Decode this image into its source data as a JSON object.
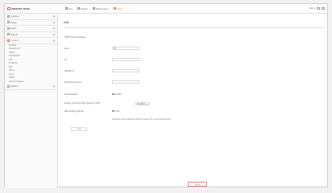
{
  "app": {
    "logo_text": "WISENET WAVE"
  },
  "topnav": [
    {
      "label": "Live",
      "icon": "monitor-icon"
    },
    {
      "label": "Search",
      "icon": "search-icon"
    },
    {
      "label": "Maintenance",
      "icon": "wrench-icon"
    },
    {
      "label": "Setup",
      "icon": "gear-icon",
      "active": true
    }
  ],
  "topright": {
    "user": "admin",
    "icons": [
      "help-icon",
      "logout-icon"
    ]
  },
  "sidebar": {
    "groups": [
      {
        "label": "Camera"
      },
      {
        "label": "Setup"
      },
      {
        "label": "Event"
      },
      {
        "label": "Record"
      },
      {
        "label": "Network",
        "open": true,
        "items": [
          "IP Setup",
          "Network port",
          "DDNS",
          "Fixed DDNS",
          "P2P",
          "IP filtering",
          "SSL",
          "802.1x",
          "Email",
          "SNMP",
          "Auto IP configure"
        ]
      },
      {
        "label": "System"
      }
    ]
  },
  "main": {
    "title": "Mail",
    "section_title": "SMTP Server Settings",
    "fields": [
      {
        "label": "Host",
        "value": "25"
      },
      {
        "label": "ID",
        "value": ""
      },
      {
        "label": "Password",
        "value": ""
      },
      {
        "label": "Mail Sender (from)",
        "value": ""
      }
    ],
    "auth_label": "Authentication",
    "auth_checkbox_label": "Enable",
    "tls_label": "Enable Transport Layer Security (TLS)",
    "tls_select_value": "Disabled",
    "interval_label": "Mail sending interval",
    "interval_option": "1 sec",
    "note": "Sends an email notification with the image of the event that occurred.",
    "test_button": "Test",
    "apply_button": "Apply"
  }
}
